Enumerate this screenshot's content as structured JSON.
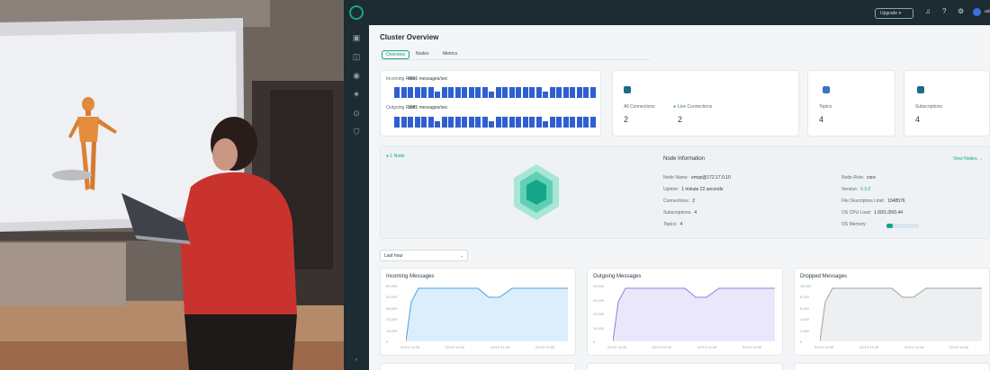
{
  "header": {
    "upgrade_label": "Upgrade",
    "user_label": "adm"
  },
  "page": {
    "title": "Cluster Overview"
  },
  "tabs": [
    {
      "label": "Overview"
    },
    {
      "label": "Nodes"
    },
    {
      "label": "Metrics"
    }
  ],
  "rates": {
    "incoming_label": "Incoming Rate:",
    "incoming_value": "4656 messages/sec",
    "outgoing_label": "Outgoing Rate:",
    "outgoing_value": "3985 messages/sec"
  },
  "stats": {
    "all_connections": {
      "label": "All Connections",
      "value": "2"
    },
    "live_connections": {
      "label": "Live Connections",
      "value": "2"
    },
    "topics": {
      "label": "Topics",
      "value": "4"
    },
    "subscriptions": {
      "label": "Subscriptions",
      "value": "4"
    }
  },
  "node": {
    "badge": "1 Node",
    "section_title": "Node Information",
    "view_link": "View Nodes",
    "fields_left": [
      {
        "label": "Node Name:",
        "value": "emqx@172.17.0.10"
      },
      {
        "label": "Uptime:",
        "value": "1 minute 22 seconds"
      },
      {
        "label": "Connections:",
        "value": "2"
      },
      {
        "label": "Subscriptions:",
        "value": "4"
      },
      {
        "label": "Topics:",
        "value": "4"
      }
    ],
    "fields_right": [
      {
        "label": "Node Role:",
        "value": "core"
      },
      {
        "label": "Version:",
        "value": "5.3.2"
      },
      {
        "label": "File Descriptors Limit:",
        "value": "1048576"
      },
      {
        "label": "OS CPU Load:",
        "value": "1.60/1.05/0.44"
      },
      {
        "label": "OS Memory:",
        "value": ""
      }
    ],
    "memory_fraction": 0.2
  },
  "time_range": {
    "selected": "Last hour"
  },
  "charts": [
    {
      "title": "Incoming Messages",
      "yticks": [
        "50,000",
        "40,000",
        "30,000",
        "20,000",
        "10,000",
        "0"
      ],
      "xticks": [
        "02/13 14:35",
        "02/13 14:40",
        "02/13 14:45",
        "02/13 14:50"
      ],
      "color": "#4a9fd8",
      "fill": "#dceefb"
    },
    {
      "title": "Outgoing Messages",
      "yticks": [
        "40,000",
        "30,000",
        "20,000",
        "10,000",
        "0"
      ],
      "xticks": [
        "02/13 14:35",
        "02/13 14:40",
        "02/13 14:45",
        "02/13 14:50"
      ],
      "color": "#8c7ee0",
      "fill": "#ebe7fb"
    },
    {
      "title": "Dropped Messages",
      "yticks": [
        "10,000",
        "8,000",
        "6,000",
        "4,000",
        "2,000",
        "0"
      ],
      "xticks": [
        "02/13 14:35",
        "02/13 14:40",
        "02/13 14:45",
        "02/13 14:50"
      ],
      "color": "#9aa3a8",
      "fill": "#eeeff0"
    }
  ],
  "colors": {
    "accent": "#17a589",
    "sidebar": "#1d2b32",
    "bar": "#2f5fd0"
  },
  "icons": [
    "logo-icon",
    "dashboard-icon",
    "monitor-icon",
    "gear-icon",
    "search-icon",
    "shield-icon",
    "bell-icon",
    "help-icon",
    "settings-icon"
  ]
}
